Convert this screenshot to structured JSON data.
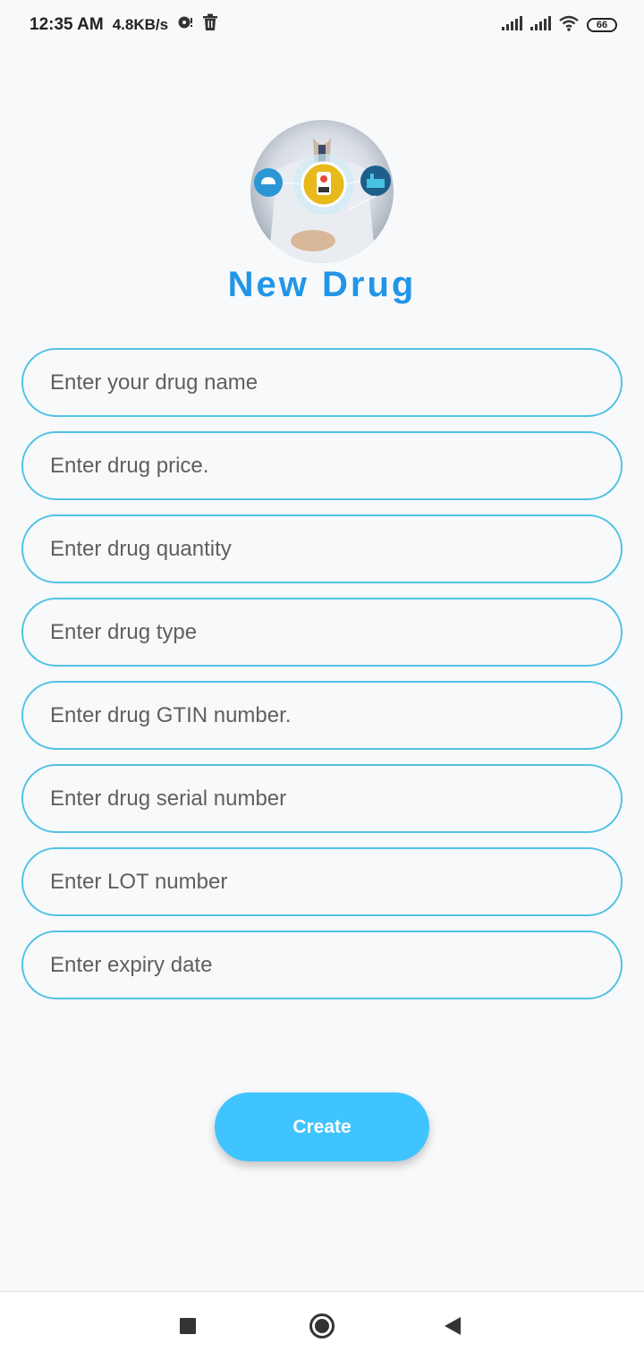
{
  "status_bar": {
    "time": "12:35 AM",
    "speed": "4.8KB/s",
    "battery": "66",
    "icons": [
      "disc-alert-icon",
      "trash-icon",
      "signal-icon",
      "signal-icon",
      "wifi-icon",
      "battery-icon"
    ]
  },
  "header": {
    "title": "New Drug",
    "image_icon": "doctor-pharma-avatar"
  },
  "form": {
    "fields": [
      {
        "placeholder": "Enter your drug name",
        "value": ""
      },
      {
        "placeholder": "Enter drug price.",
        "value": ""
      },
      {
        "placeholder": "Enter drug quantity",
        "value": ""
      },
      {
        "placeholder": "Enter drug type",
        "value": ""
      },
      {
        "placeholder": "Enter drug GTIN number.",
        "value": ""
      },
      {
        "placeholder": "Enter drug serial number",
        "value": ""
      },
      {
        "placeholder": "Enter LOT number",
        "value": ""
      },
      {
        "placeholder": "Enter expiry date",
        "value": ""
      }
    ]
  },
  "actions": {
    "create_label": "Create"
  },
  "nav": {
    "icons": [
      "square-icon",
      "circle-icon",
      "triangle-back-icon"
    ]
  },
  "colors": {
    "accent": "#2196e8",
    "field_border": "#4fc3e3",
    "button": "#40c4ff",
    "background": "#f8f9fa"
  }
}
